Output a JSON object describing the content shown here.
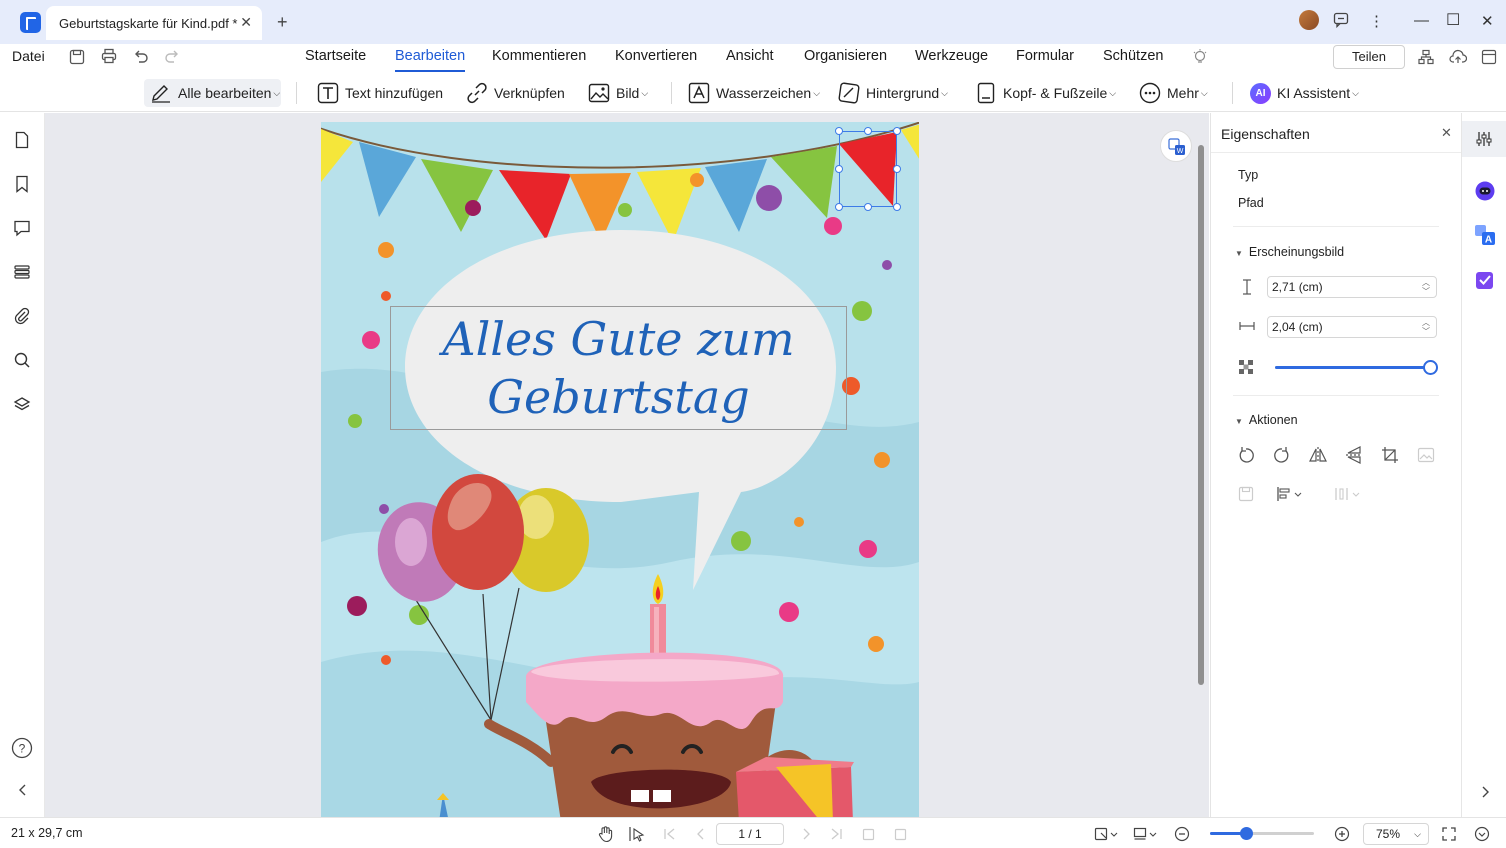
{
  "window": {
    "tab_title": "Geburtstagskarte für Kind.pdf *",
    "new_tab": "+"
  },
  "menu": {
    "file": "Datei",
    "items": [
      "Startseite",
      "Bearbeiten",
      "Kommentieren",
      "Konvertieren",
      "Ansicht",
      "Organisieren",
      "Werkzeuge",
      "Formular",
      "Schützen"
    ],
    "active": "Bearbeiten",
    "share": "Teilen"
  },
  "toolbar": {
    "edit_all": "Alle bearbeiten",
    "add_text": "Text hinzufügen",
    "link": "Verknüpfen",
    "image": "Bild",
    "watermark": "Wasserzeichen",
    "background": "Hintergrund",
    "header_footer": "Kopf- & Fußzeile",
    "more": "Mehr",
    "ai": "KI Assistent",
    "ai_badge": "AI"
  },
  "document": {
    "greeting_line1": "Alles Gute zum",
    "greeting_line2": "Geburtstag"
  },
  "properties": {
    "title": "Eigenschaften",
    "type_label": "Typ",
    "type_value": "Pfad",
    "appearance": "Erscheinungsbild",
    "height_value": "2,71 (cm)",
    "width_value": "2,04 (cm)",
    "opacity": 1.0,
    "actions": "Aktionen"
  },
  "status": {
    "page_size": "21 x 29,7 cm",
    "page_indicator": "1 / 1",
    "zoom": "75%",
    "zoom_slider": 0.35
  },
  "colors": {
    "accent": "#1f5bd6",
    "page_bg": "#b9e2ec",
    "canvas_bg": "#e8e9ee"
  }
}
